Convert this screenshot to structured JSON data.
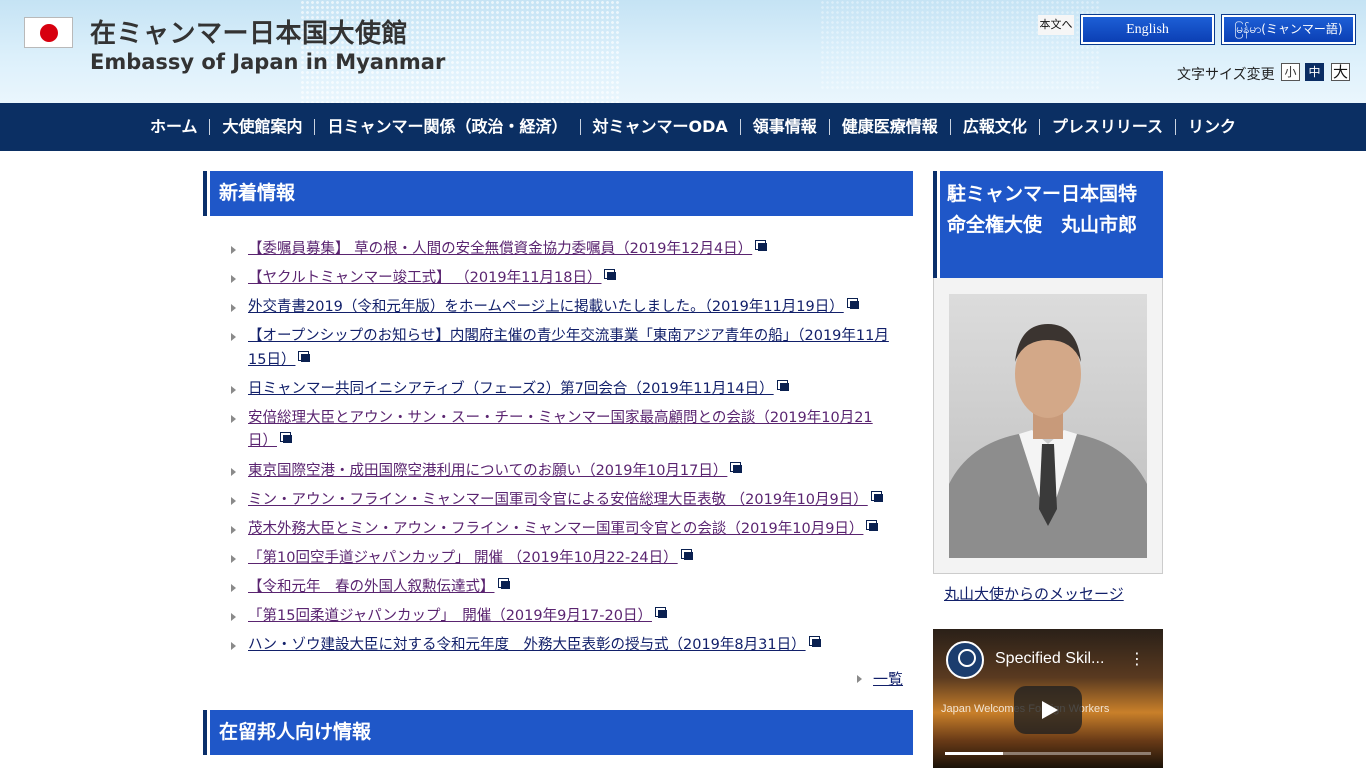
{
  "header": {
    "title_ja": "在ミャンマー日本国大使館",
    "title_en": "Embassy of Japan in Myanmar",
    "skip_link": "本文へ",
    "lang_english": "English",
    "lang_myanmar": "မြန်မာ(ミャンマー語)",
    "font_size_label": "文字サイズ変更",
    "font_small": "小",
    "font_medium": "中",
    "font_large": "大"
  },
  "nav": {
    "items": [
      "ホーム",
      "大使館案内",
      "日ミャンマー関係（政治・経済）",
      "対ミャンマーODA",
      "領事情報",
      "健康医療情報",
      "広報文化",
      "プレスリリース",
      "リンク"
    ]
  },
  "news": {
    "heading": "新着情報",
    "items": [
      "【委嘱員募集】 草の根・人間の安全無償資金協力委嘱員（2019年12月4日）",
      "【ヤクルトミャンマー竣工式】 （2019年11月18日）",
      "外交青書2019（令和元年版）をホームページ上に掲載いたしました。（2019年11月19日）",
      "【オープンシップのお知らせ】内閣府主催の青少年交流事業「東南アジア青年の船」（2019年11月15日）",
      "日ミャンマー共同イニシアティブ（フェーズ2）第7回会合（2019年11月14日）",
      "安倍総理大臣とアウン・サン・スー・チー・ミャンマー国家最高顧問との会談（2019年10月21日）",
      "東京国際空港・成田国際空港利用についてのお願い（2019年10月17日）",
      "ミン・アウン・フライン・ミャンマー国軍司令官による安倍総理大臣表敬 （2019年10月9日）",
      "茂木外務大臣とミン・アウン・フライン・ミャンマー国軍司令官との会談（2019年10月9日）",
      "「第10回空手道ジャパンカップ」 開催 （2019年10月22-24日）",
      "【令和元年　春の外国人叙勲伝達式】",
      "「第15回柔道ジャパンカップ」　開催（2019年9月17-20日）",
      "ハン・ゾウ建設大臣に対する令和元年度　外務大臣表彰の授与式（2019年8月31日）"
    ],
    "more_link": "一覧"
  },
  "residents": {
    "heading": "在留邦人向け情報"
  },
  "sidebar": {
    "ambassador_heading": "駐ミャンマー日本国特命全権大使　丸山市郎",
    "ambassador_link": "丸山大使からのメッセージ",
    "video_title": "Specified Skil...",
    "video_caption": "Japan Welcomes Foreign Workers"
  },
  "colors": {
    "nav_bg": "#0b2f63",
    "heading_bg": "#1f57c8",
    "link_visited": "#5a2470",
    "link": "#12206a"
  }
}
